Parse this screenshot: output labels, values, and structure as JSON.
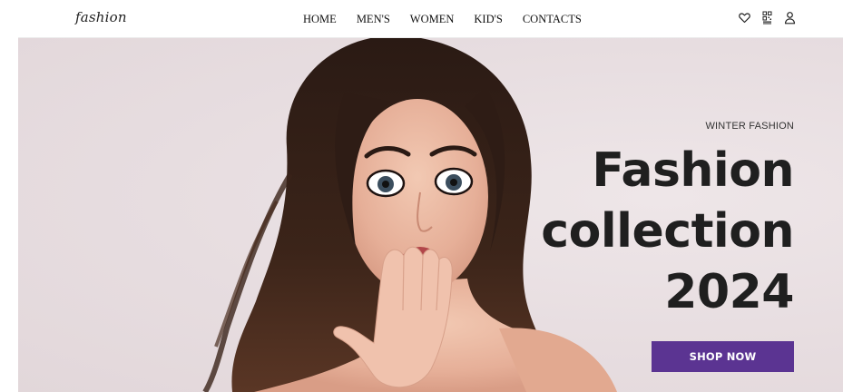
{
  "brand": {
    "logo_text": "fashion"
  },
  "nav": {
    "items": [
      "HOME",
      "MEN'S",
      "WOMEN",
      "KID'S",
      "CONTACTS"
    ]
  },
  "header_icons": [
    "heart-icon",
    "qr-code-icon",
    "user-icon"
  ],
  "hero": {
    "eyebrow": "WINTER FASHION",
    "headline_lines": [
      "Fashion",
      "collection",
      "2024"
    ],
    "cta_label": "SHOP NOW"
  },
  "colors": {
    "accent": "#5b3492",
    "hero_background": "#e9e0e2",
    "headline": "#1f1f1f"
  }
}
